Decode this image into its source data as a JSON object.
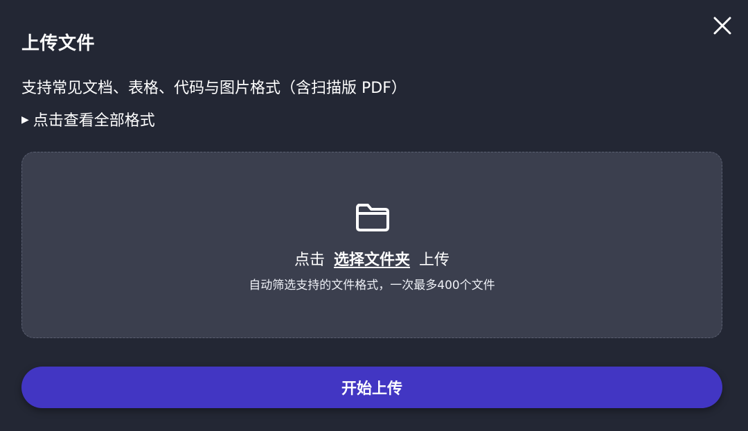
{
  "dialog": {
    "title": "上传文件",
    "description": "支持常见文档、表格、代码与图片格式（含扫描版 PDF）",
    "formats_toggle": {
      "glyph": "▶",
      "label": "点击查看全部格式"
    },
    "close_icon": "close-icon"
  },
  "dropzone": {
    "icon": "folder-icon",
    "prefix": "点击",
    "link_label": "选择文件夹",
    "suffix": "上传",
    "hint": "自动筛选支持的文件格式，一次最多400个文件"
  },
  "actions": {
    "start_label": "开始上传"
  },
  "colors": {
    "background": "#232734",
    "dropzone_bg": "#3b3f4e",
    "dropzone_border": "#5b6072",
    "primary": "#4236c3",
    "text": "#ffffff"
  }
}
